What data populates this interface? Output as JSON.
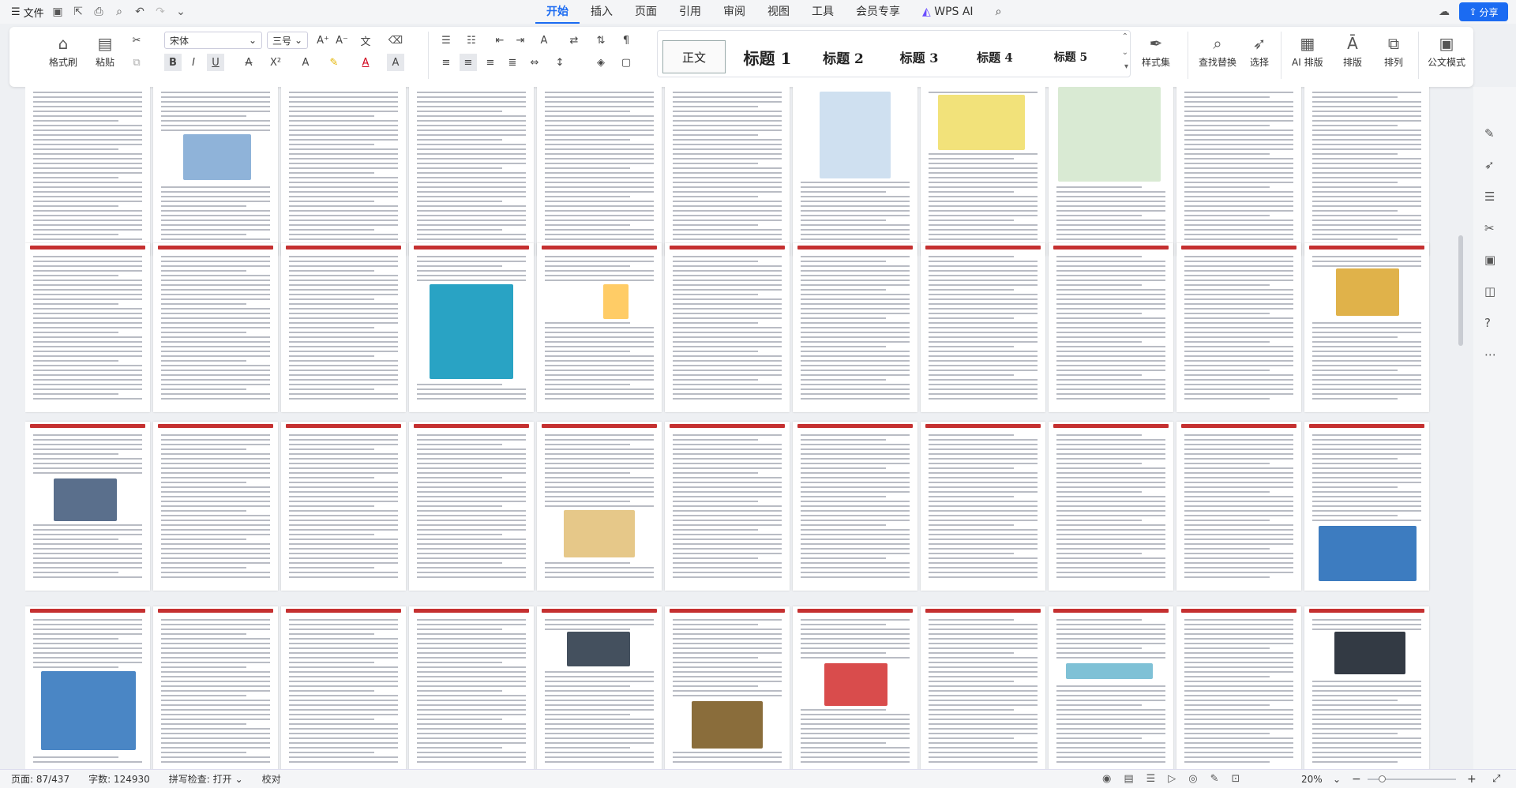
{
  "topbar": {
    "file_label": "文件",
    "tabs": [
      "开始",
      "插入",
      "页面",
      "引用",
      "审阅",
      "视图",
      "工具",
      "会员专享",
      "WPS AI"
    ],
    "active_tab": "开始",
    "share_label": "分享"
  },
  "ribbon": {
    "format_painter": "格式刷",
    "paste": "粘贴",
    "font_name": "宋体",
    "font_size": "三号",
    "styles": [
      "正文",
      "标题 1",
      "标题 2",
      "标题 3",
      "标题 4",
      "标题 5"
    ],
    "style_set": "样式集",
    "find_replace": "查找替换",
    "select": "选择",
    "ai_layout": "AI 排版",
    "layout": "排版",
    "arrange": "排列",
    "official_mode": "公文模式"
  },
  "status": {
    "page": "页面: 87/437",
    "words": "字数: 124930",
    "spell": "拼写检查: 打开",
    "proof": "校对",
    "zoom": "20%"
  },
  "colors": {
    "accent": "#1b6bf2",
    "header_red": "#c53030"
  }
}
